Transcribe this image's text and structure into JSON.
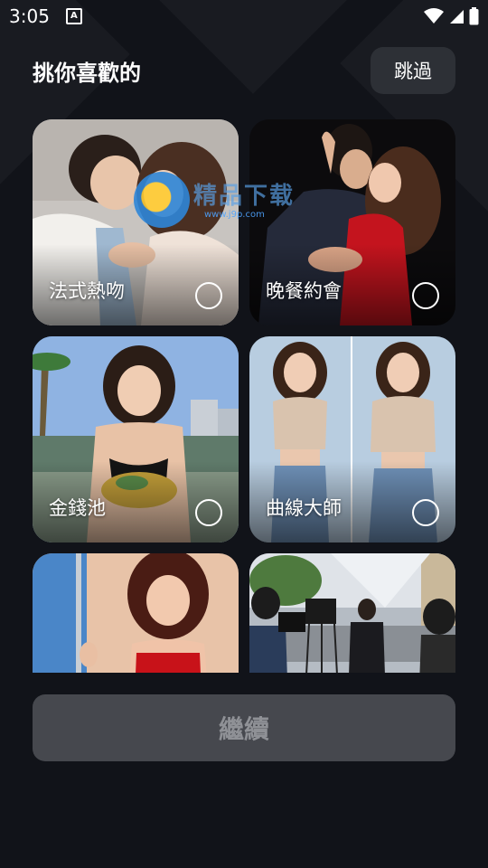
{
  "status": {
    "time": "3:05",
    "app_badge": "A"
  },
  "header": {
    "title": "挑你喜歡的",
    "skip_label": "跳過"
  },
  "watermark": {
    "brand": "精品下载",
    "url": "www.j9p.com"
  },
  "cards": [
    {
      "label": "法式熱吻",
      "selected": false
    },
    {
      "label": "晚餐約會",
      "selected": false
    },
    {
      "label": "金錢池",
      "selected": false
    },
    {
      "label": "曲線大師",
      "selected": false
    },
    {
      "label": "",
      "selected": false
    },
    {
      "label": "",
      "selected": false
    }
  ],
  "footer": {
    "continue_label": "繼續"
  },
  "colors": {
    "background": "#111319",
    "skip_bg": "#2d3036",
    "continue_bg": "#46484e",
    "continue_text": "#8f9196"
  },
  "icons": [
    "wifi-icon",
    "signal-icon",
    "battery-icon",
    "radio-unchecked-icon"
  ]
}
